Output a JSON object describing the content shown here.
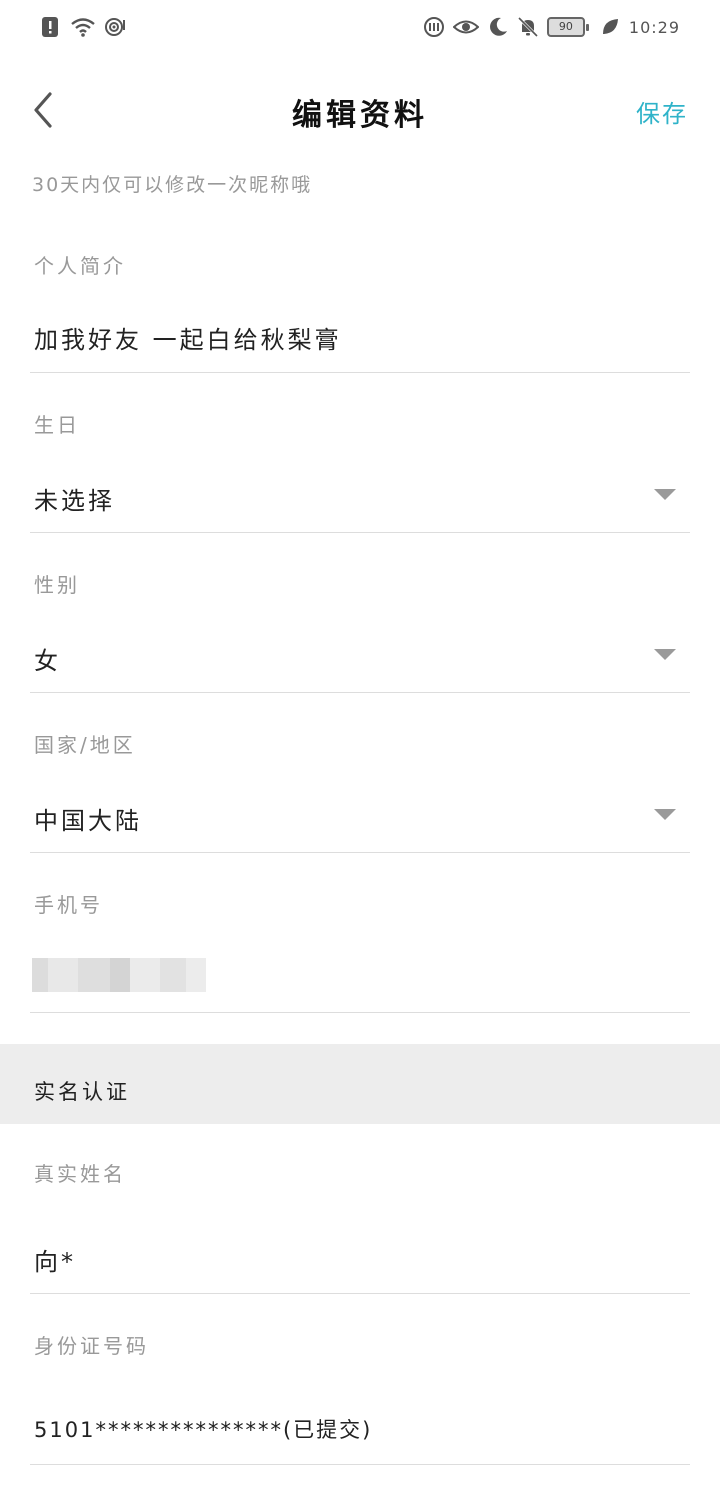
{
  "status_bar": {
    "time": "10:29",
    "battery": "90",
    "left_icons": [
      "alert-icon",
      "wifi-icon",
      "hotspot-icon"
    ],
    "right_icons": [
      "nfc-icon",
      "eye-icon",
      "moon-icon",
      "bell-off-icon",
      "battery-icon",
      "leaf-icon"
    ]
  },
  "header": {
    "title": "编辑资料",
    "save_label": "保存"
  },
  "nickname_hint": "30天内仅可以修改一次昵称哦",
  "fields": {
    "bio": {
      "label": "个人简介",
      "value": "加我好友 一起白给秋梨膏"
    },
    "birthday": {
      "label": "生日",
      "value": "未选择"
    },
    "gender": {
      "label": "性别",
      "value": "女"
    },
    "region": {
      "label": "国家/地区",
      "value": "中国大陆"
    },
    "phone": {
      "label": "手机号",
      "value": ""
    }
  },
  "realname_section": {
    "title": "实名认证",
    "name": {
      "label": "真实姓名",
      "value": "向*"
    },
    "id_number": {
      "label": "身份证号码",
      "value": "5101***************(已提交)"
    }
  },
  "colors": {
    "accent": "#2fb3c9",
    "section_bg": "#ededed",
    "label": "#999999",
    "divider": "#dddddd"
  }
}
